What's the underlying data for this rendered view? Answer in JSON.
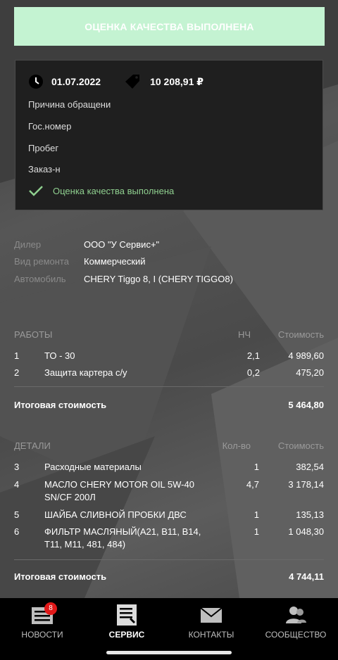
{
  "banner": {
    "text": "ОЦЕНКА КАЧЕСТВА ВЫПОЛНЕНА"
  },
  "card": {
    "date": "01.07.2022",
    "price": "10 208,91 ₽",
    "reason_label": "Причина обращени",
    "plate_label": "Гос.номер",
    "mileage_label": "Пробег",
    "order_label": "Заказ-н",
    "status": "Оценка качества выполнена",
    "colors": {
      "status": "#8fcf8f",
      "banner": "#c4f3d2"
    }
  },
  "info": {
    "dealer_label": "Дилер",
    "dealer_value": "ООО \"У Сервис+\"",
    "repair_label": "Вид ремонта",
    "repair_value": "Коммерческий",
    "car_label": "Автомобиль",
    "car_value": "CHERY Tiggo 8, I (CHERY TIGGO8)"
  },
  "works": {
    "header": {
      "title": "РАБОТЫ",
      "qty": "НЧ",
      "cost": "Стоимость"
    },
    "rows": [
      {
        "n": "1",
        "name": "ТО - 30",
        "qty": "2,1",
        "cost": "4 989,60"
      },
      {
        "n": "2",
        "name": "Защита картера с/у",
        "qty": "0,2",
        "cost": "475,20"
      }
    ],
    "total_label": "Итоговая стоимость",
    "total_value": "5 464,80"
  },
  "parts": {
    "header": {
      "title": "ДЕТАЛИ",
      "qty": "Кол-во",
      "cost": "Стоимость"
    },
    "rows": [
      {
        "n": "3",
        "name": "Расходные материалы",
        "qty": "1",
        "cost": "382,54"
      },
      {
        "n": "4",
        "name": "МАСЛО CHERY MOTOR OIL 5W-40 SN/CF  200Л",
        "qty": "4,7",
        "cost": "3 178,14"
      },
      {
        "n": "5",
        "name": "ШАЙБА СЛИВНОЙ ПРОБКИ ДВС",
        "qty": "1",
        "cost": "135,13"
      },
      {
        "n": "6",
        "name": "ФИЛЬТР МАСЛЯНЫЙ(A21, B11, B14, T11, M11, 481, 484)",
        "qty": "1",
        "cost": "1 048,30"
      }
    ],
    "total_label": "Итоговая стоимость",
    "total_value": "4 744,11"
  },
  "tabbar": {
    "news": {
      "label": "НОВОСТИ",
      "badge": "8",
      "icon": "news-icon"
    },
    "service": {
      "label": "СЕРВИС",
      "icon": "service-icon"
    },
    "contacts": {
      "label": "КОНТАКТЫ",
      "icon": "mail-icon"
    },
    "community": {
      "label": "СООБЩЕСТВО",
      "icon": "community-icon"
    }
  }
}
